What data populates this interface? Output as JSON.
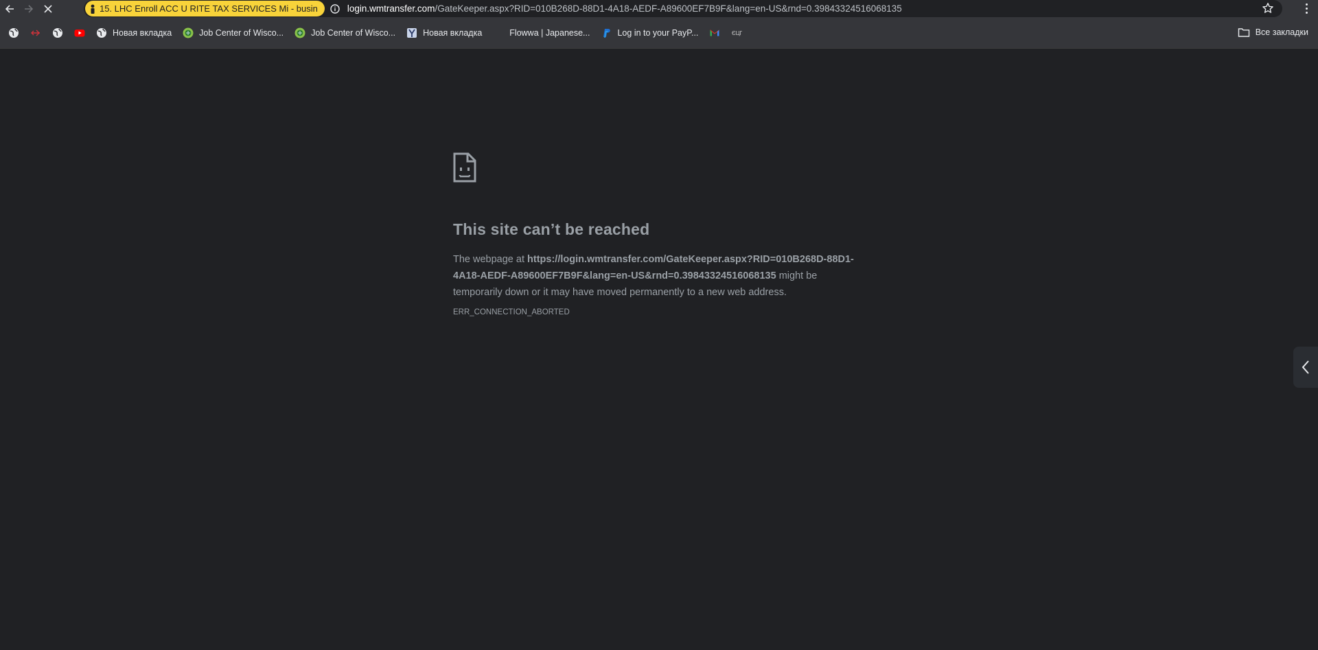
{
  "toolbar": {
    "tab_chip_label": "15. LHC Enroll  ACC U RITE TAX SERVICES Mi - busin",
    "url_host": "login.wmtransfer.com",
    "url_path": "/GateKeeper.aspx?RID=010B268D-88D1-4A18-AEDF-A89600EF7B9F&lang=en-US&rnd=0.39843324516068135",
    "icons": [
      "back-icon",
      "forward-icon",
      "stop-icon",
      "info-icon",
      "star-icon",
      "menu-icon"
    ]
  },
  "bookmarks": [
    {
      "label": "",
      "icon": "globe-icon"
    },
    {
      "label": "",
      "icon": "red-arrow-icon"
    },
    {
      "label": "",
      "icon": "globe-icon"
    },
    {
      "label": "",
      "icon": "youtube-icon"
    },
    {
      "label": "Новая вкладка",
      "icon": "globe-icon"
    },
    {
      "label": "Job Center of Wisco...",
      "icon": "job-center-icon"
    },
    {
      "label": "Job Center of Wisco...",
      "icon": "job-center-icon"
    },
    {
      "label": "Новая вкладка",
      "icon": "y-icon"
    },
    {
      "label": "Flowwa | Japanese...",
      "icon": "blank-icon"
    },
    {
      "label": "Log in to your PayP...",
      "icon": "paypal-icon"
    },
    {
      "label": "",
      "icon": "gmail-icon"
    },
    {
      "label": "",
      "icon": "ecp-icon"
    }
  ],
  "all_bookmarks_label": "Все закладки",
  "error": {
    "title": "This site can’t be reached",
    "desc_prefix": "The webpage at ",
    "desc_url": "https://login.wmtransfer.com/GateKeeper.aspx?RID=010B268D-88D1-4A18-AEDF-A89600EF7B9F&lang=en-US&rnd=0.39843324516068135",
    "desc_suffix": " might be temporarily down or it may have moved permanently to a new web address.",
    "code": "ERR_CONNECTION_ABORTED"
  },
  "colors": {
    "background": "#202124",
    "toolbar": "#35363a",
    "tab_chip": "#f8d33a",
    "error_text": "#9aa0a6"
  }
}
